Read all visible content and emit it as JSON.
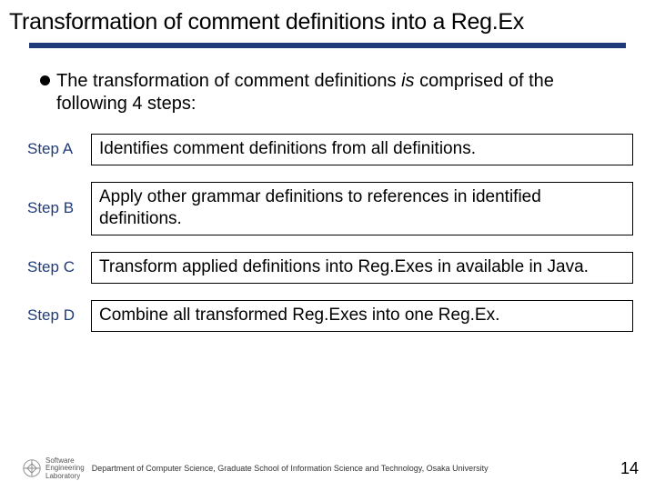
{
  "title": "Transformation of comment definitions into a Reg.Ex",
  "intro": {
    "pre": "The transformation of comment definitions ",
    "italic": "is",
    "post": " comprised of the following 4 steps:"
  },
  "steps": [
    {
      "label": "Step A",
      "text": "Identifies comment definitions from all definitions."
    },
    {
      "label": "Step B",
      "text": "Apply other grammar definitions to references in identified definitions."
    },
    {
      "label": "Step C",
      "text": "Transform applied definitions into Reg.Exes in available in Java."
    },
    {
      "label": "Step D",
      "text": "Combine all transformed Reg.Exes into one Reg.Ex."
    }
  ],
  "footer": {
    "logo_line1": "Software",
    "logo_line2": "Engineering",
    "logo_line3": "Laboratory",
    "dept": "Department of Computer Science, Graduate School of Information Science and Technology, Osaka University",
    "page": "14"
  }
}
